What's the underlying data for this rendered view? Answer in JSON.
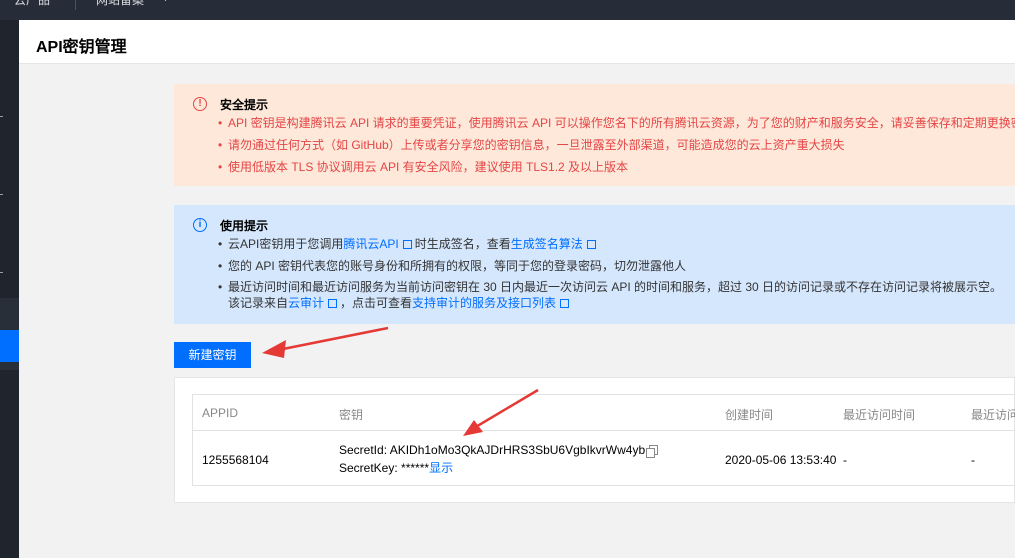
{
  "topbar": {
    "items": [
      "云产品",
      "网站备案",
      "+"
    ]
  },
  "page": {
    "title": "API密钥管理"
  },
  "warning": {
    "title": "安全提示",
    "items": [
      "API 密钥是构建腾讯云 API 请求的重要凭证，使用腾讯云 API 可以操作您名下的所有腾讯云资源，为了您的财产和服务安全，请妥善保存和定期更换密钥",
      "请勿通过任何方式（如 GitHub）上传或者分享您的密钥信息，一旦泄露至外部渠道，可能造成您的云上资产重大损失",
      "使用低版本 TLS 协议调用云 API 有安全风险，建议使用 TLS1.2 及以上版本"
    ],
    "color": "#e54545",
    "bg": "#fde8da"
  },
  "info": {
    "title": "使用提示",
    "item1": {
      "pre": "云API密钥用于您调用",
      "link1": "腾讯云API",
      "mid": "时生成签名，查看",
      "link2": "生成签名算法"
    },
    "item2": "您的 API 密钥代表您的账号身份和所拥有的权限，等同于您的登录密码，切勿泄露他人",
    "item3": {
      "line1": "最近访问时间和最近访问服务为当前访问密钥在 30 日内最近一次访问云 API 的时间和服务，超过 30 日的访问记录或不存在访问记录将被展示空。",
      "line2_pre": "该记录来自",
      "line2_link1": "云审计",
      "line2_mid": "，点击可查看",
      "line2_link2": "支持审计的服务及接口列表"
    },
    "bg": "#d5e7fd",
    "link_color": "#006eff"
  },
  "create_button": "新建密钥",
  "table": {
    "columns": [
      "APPID",
      "密钥",
      "创建时间",
      "最近访问时间",
      "最近访问服"
    ],
    "rows": [
      {
        "appid": "1255568104",
        "secret_id_label": "SecretId:",
        "secret_id": "AKIDh1oMo3QkAJDrHRS3SbU6VgbIkvrWw4yb",
        "secret_key_label": "SecretKey:",
        "secret_key": "******",
        "show_link": "显示",
        "created": "2020-05-06 13:53:40",
        "last_access_time": "-",
        "last_access_service": "-"
      }
    ]
  },
  "colors": {
    "primary": "#006eff",
    "annotation_arrow": "#e53935",
    "sidebar": "#1f242d"
  }
}
